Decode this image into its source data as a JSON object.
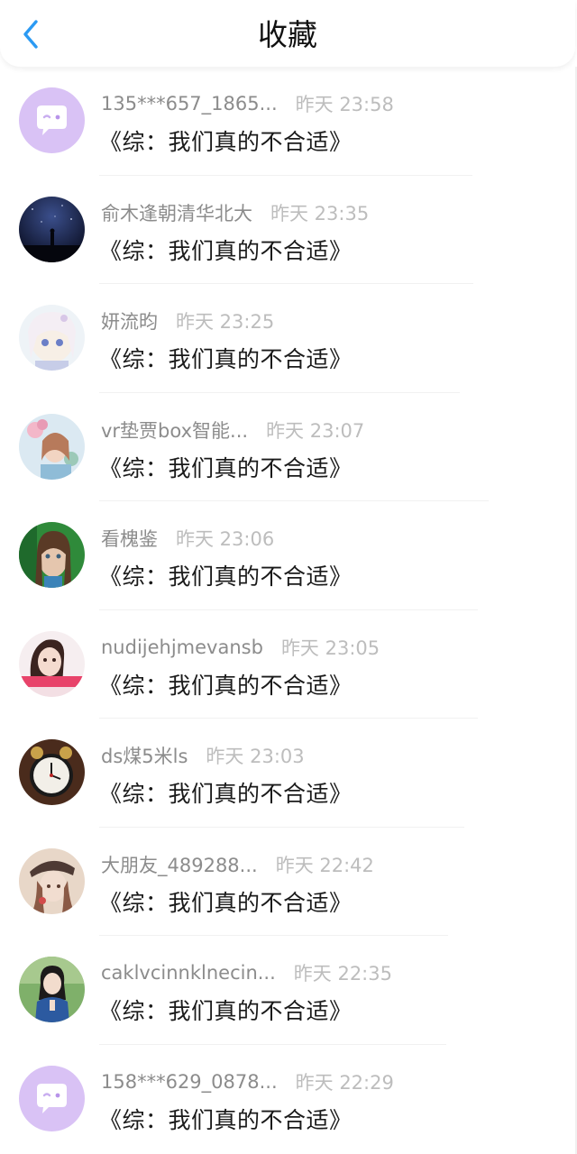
{
  "header": {
    "title": "收藏",
    "back_icon": "chevron-left-icon",
    "accent_color": "#2b9af3"
  },
  "items": [
    {
      "user": "135***657_1865...",
      "time": "昨天 23:58",
      "title": "《综：我们真的不合适》",
      "avatar": "default-chat-bubble"
    },
    {
      "user": "俞木逢朝清华北大",
      "time": "昨天 23:35",
      "title": "《综：我们真的不合适》",
      "avatar": "night-sky-photo"
    },
    {
      "user": "妍流昀",
      "time": "昨天 23:25",
      "title": "《综：我们真的不合适》",
      "avatar": "anime-girl-photo"
    },
    {
      "user": "vr垫贾box智能...",
      "time": "昨天 23:07",
      "title": "《综：我们真的不合适》",
      "avatar": "girl-flowers-photo"
    },
    {
      "user": "看槐鉴",
      "time": "昨天 23:06",
      "title": "《综：我们真的不合适》",
      "avatar": "girl-portrait-photo"
    },
    {
      "user": "nudijehjmevansb",
      "time": "昨天 23:05",
      "title": "《综：我们真的不合适》",
      "avatar": "girl-pink-photo"
    },
    {
      "user": "ds煤5米ls",
      "time": "昨天 23:03",
      "title": "《综：我们真的不合适》",
      "avatar": "alarm-clock-photo"
    },
    {
      "user": "大朋友_489288...",
      "time": "昨天 22:42",
      "title": "《综：我们真的不合适》",
      "avatar": "illustration-girl-photo"
    },
    {
      "user": "caklvcinnklnecin...",
      "time": "昨天 22:35",
      "title": "《综：我们真的不合适》",
      "avatar": "girl-denim-photo"
    },
    {
      "user": "158***629_0878...",
      "time": "昨天 22:29",
      "title": "《综：我们真的不合适》",
      "avatar": "default-chat-bubble"
    }
  ]
}
